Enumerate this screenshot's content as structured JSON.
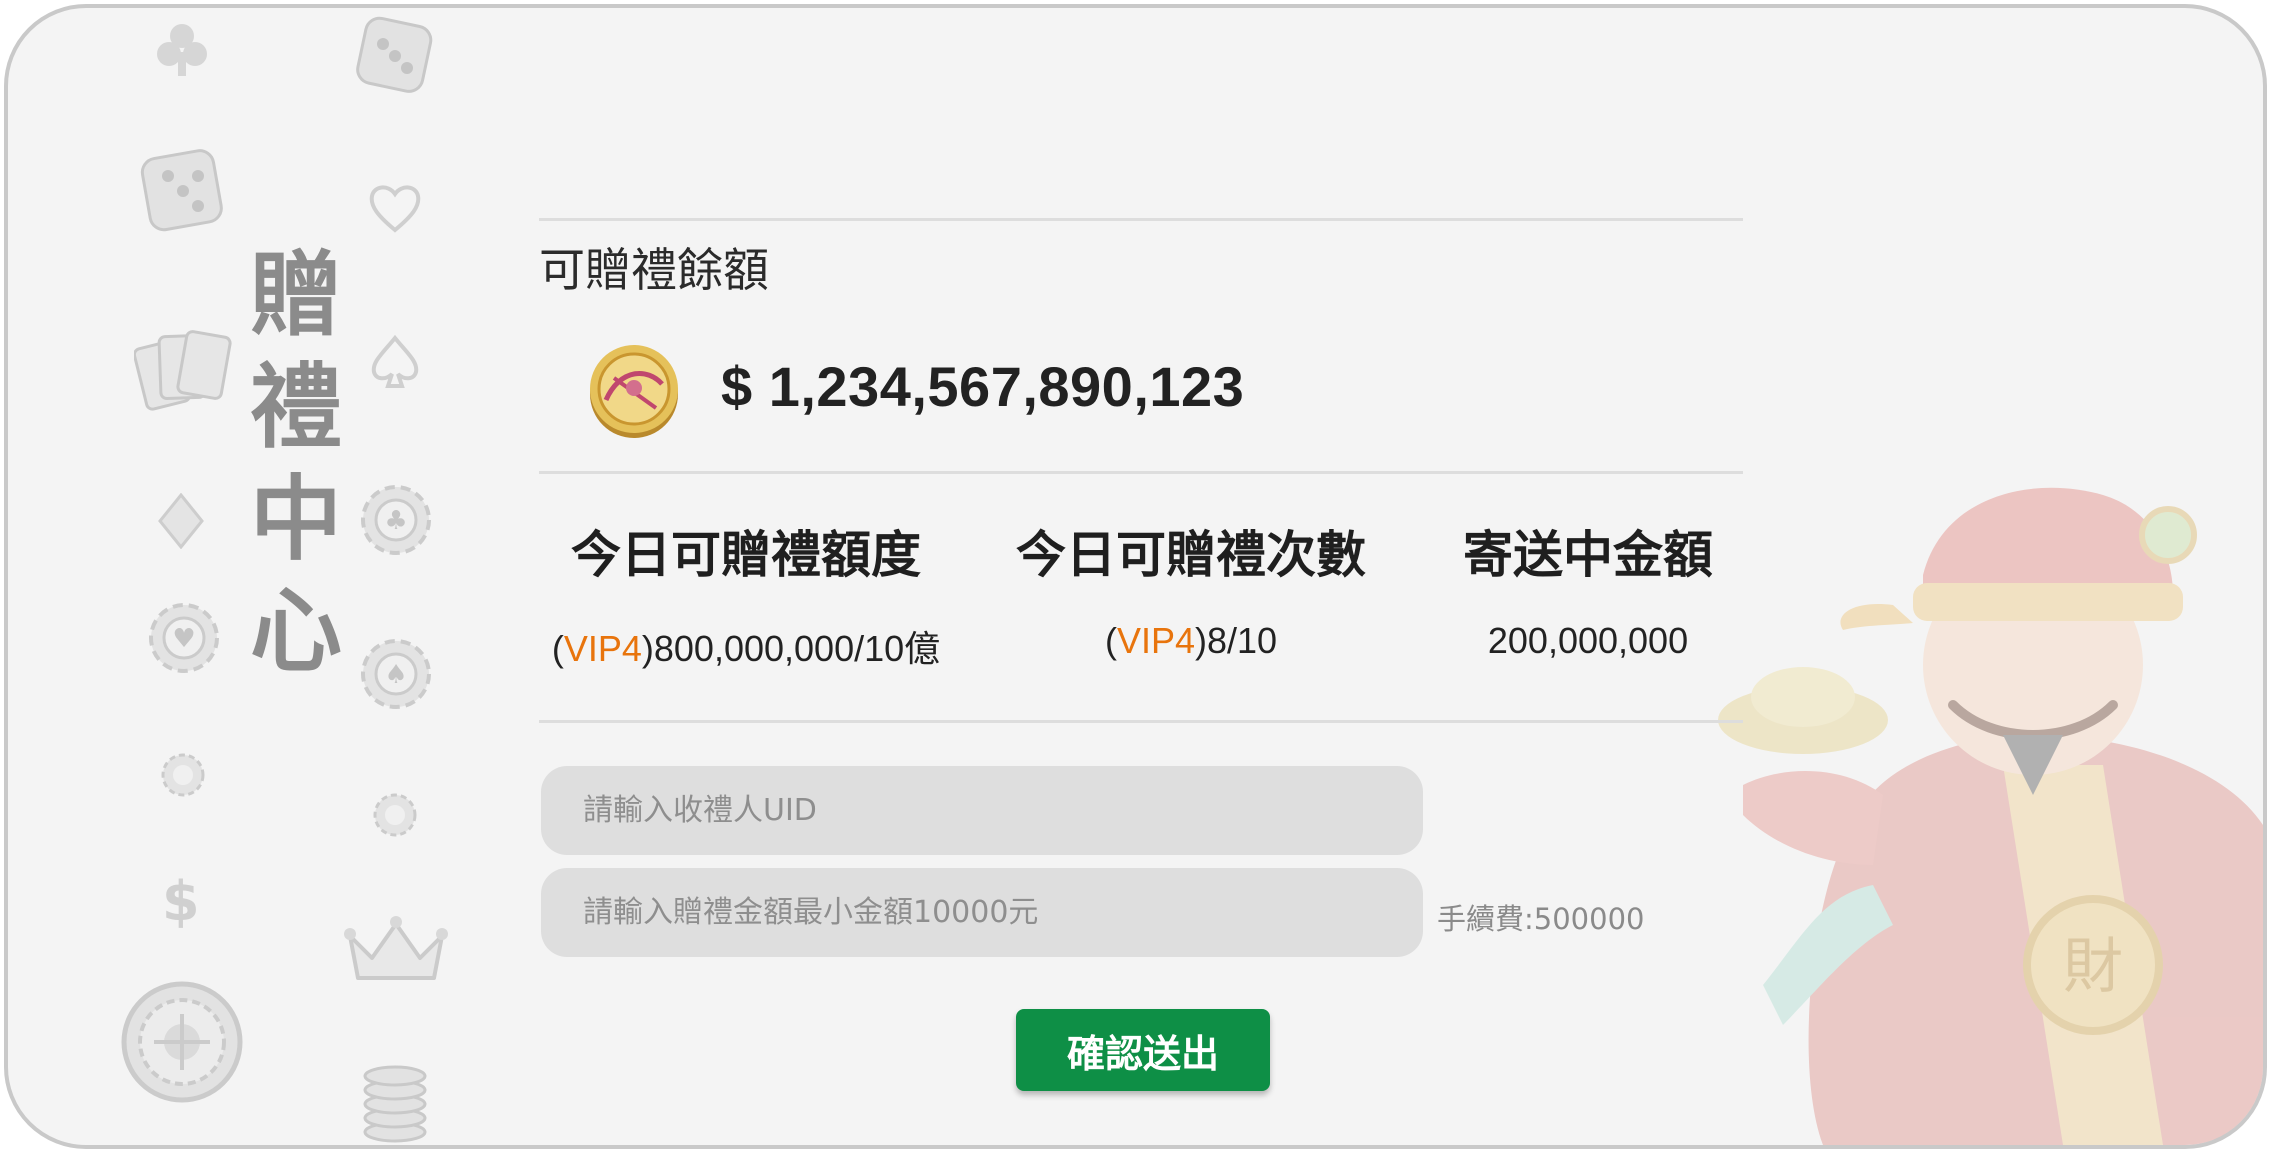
{
  "sidebar": {
    "title_chars": [
      "贈",
      "禮",
      "中",
      "心"
    ]
  },
  "balance": {
    "label": "可贈禮餘額",
    "amount": "$ 1,234,567,890,123"
  },
  "stats": [
    {
      "title": "今日可贈禮額度",
      "vip": "VIP4",
      "value": "800,000,000/10億"
    },
    {
      "title": "今日可贈禮次數",
      "vip": "VIP4",
      "value": "8/10"
    },
    {
      "title": "寄送中金額",
      "value": "200,000,000"
    }
  ],
  "form": {
    "uid_placeholder": "請輸入收禮人UID",
    "amount_placeholder": "請輸入贈禮金額最小金額10000元",
    "fee_text": "手續費:500000",
    "submit_label": "確認送出"
  },
  "colors": {
    "accent_vip": "#e8740c",
    "submit_bg": "#0e8f46",
    "panel_bg": "#f4f4f4"
  },
  "icons": [
    "club-icon",
    "dice-icon",
    "heart-icon",
    "cards-icon",
    "spade-icon",
    "diamond-icon",
    "chip-icon",
    "dollar-icon",
    "crown-icon",
    "roulette-icon",
    "coin-stack-icon",
    "gold-coin-icon"
  ]
}
